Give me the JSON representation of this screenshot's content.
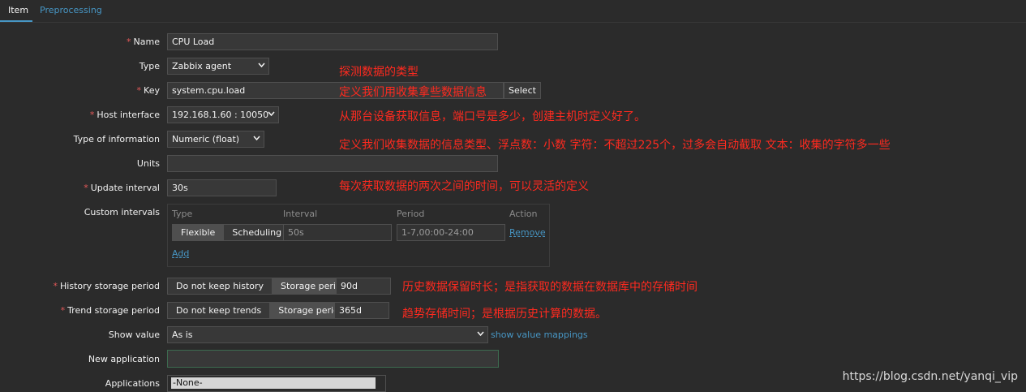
{
  "tabs": {
    "item": "Item",
    "preprocessing": "Preprocessing"
  },
  "labels": {
    "name": "Name",
    "type": "Type",
    "key": "Key",
    "host_interface": "Host interface",
    "type_of_information": "Type of information",
    "units": "Units",
    "update_interval": "Update interval",
    "custom_intervals": "Custom intervals",
    "history_storage_period": "History storage period",
    "trend_storage_period": "Trend storage period",
    "show_value": "Show value",
    "new_application": "New application",
    "applications": "Applications"
  },
  "required_mark": "*",
  "fields": {
    "name": "CPU Load",
    "type": "Zabbix agent",
    "key": "system.cpu.load",
    "key_select_button": "Select",
    "host_interface": "192.168.1.60 : 10050",
    "type_of_information": "Numeric (float)",
    "units": "",
    "update_interval": "30s",
    "history_value": "90d",
    "trend_value": "365d",
    "show_value": "As is",
    "show_value_link": "show value mappings",
    "new_application": "",
    "applications_selected": "-None-"
  },
  "custom_intervals": {
    "headers": {
      "type": "Type",
      "interval": "Interval",
      "period": "Period",
      "action": "Action"
    },
    "type_options": [
      "Flexible",
      "Scheduling"
    ],
    "selected_type": "Flexible",
    "interval_value": "50s",
    "period_value": "1-7,00:00-24:00",
    "remove": "Remove",
    "add": "Add"
  },
  "history_options": [
    "Do not keep history",
    "Storage period"
  ],
  "trend_options": [
    "Do not keep trends",
    "Storage period"
  ],
  "annotations": {
    "type": "探测数据的类型",
    "key": "定义我们用收集拿些数据信息",
    "host_interface": "从那台设备获取信息，端口号是多少，创建主机时定义好了。",
    "type_of_information": "定义我们收集数据的信息类型、浮点数：小数     字符：不超过225个，过多会自动截取       文本：收集的字符多一些",
    "update_interval": "每次获取数据的两次之间的时间，可以灵活的定义",
    "history": "历史数据保留时长；是指获取的数据在数据库中的存储时间",
    "trend": "趋势存储时间；是根据历史计算的数据。"
  },
  "watermark": "https://blog.csdn.net/yanqi_vip",
  "colors": {
    "background": "#2b2b2b",
    "link": "#4796c4",
    "annotation": "#ff2a1f",
    "required": "#e45959"
  }
}
